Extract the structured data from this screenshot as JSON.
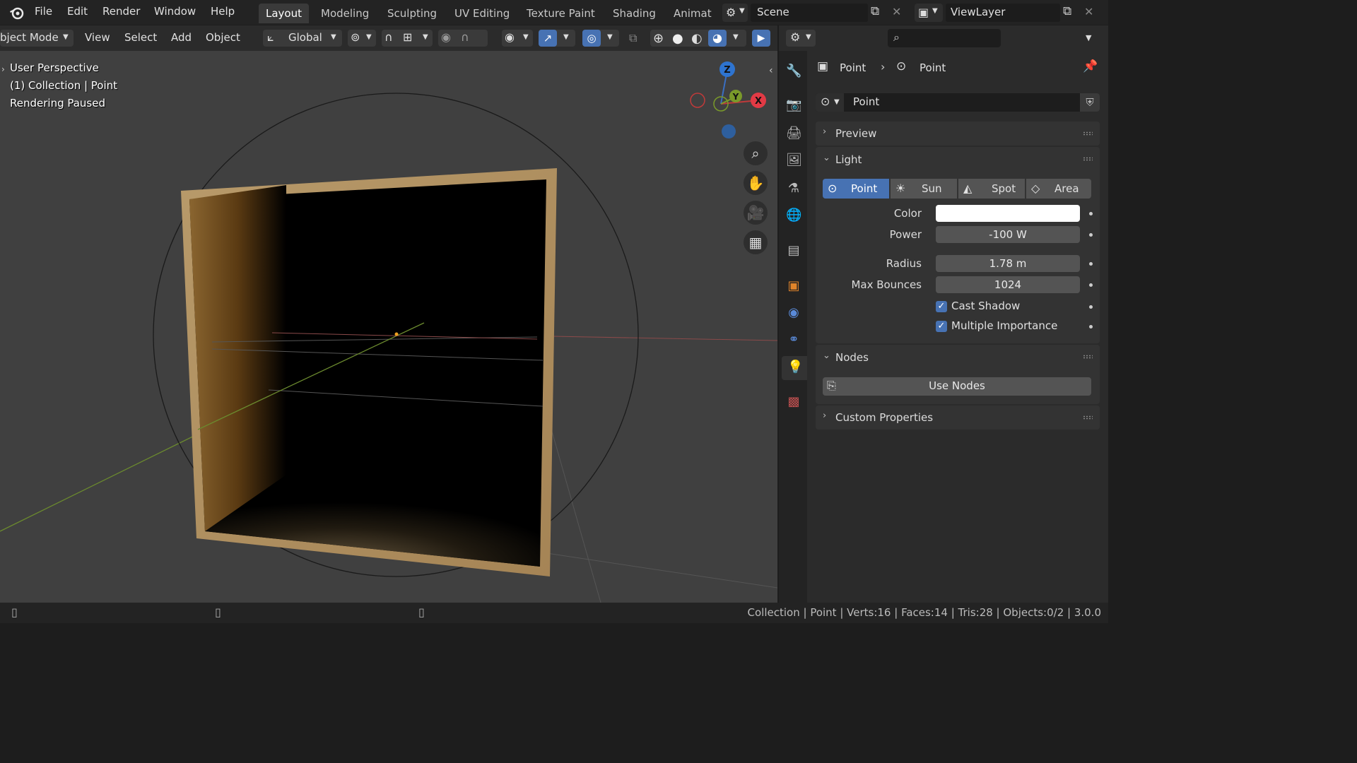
{
  "menu": {
    "file": "File",
    "edit": "Edit",
    "render": "Render",
    "window": "Window",
    "help": "Help"
  },
  "workspaces": [
    "Layout",
    "Modeling",
    "Sculpting",
    "UV Editing",
    "Texture Paint",
    "Shading",
    "Animat"
  ],
  "scene": {
    "name": "Scene",
    "view_layer": "ViewLayer"
  },
  "viewport_header": {
    "mode": "bject Mode",
    "view": "View",
    "select": "Select",
    "add": "Add",
    "object": "Object",
    "orientation": "Global"
  },
  "viewport_overlay": {
    "perspective": "User Perspective",
    "collection": "(1) Collection | Point",
    "status": "Rendering Paused"
  },
  "gizmo": {
    "z": "Z",
    "y": "Y",
    "x": "X"
  },
  "properties": {
    "breadcrumb_object": "Point",
    "breadcrumb_data": "Point",
    "datablock_name": "Point",
    "preview_title": "Preview",
    "light_title": "Light",
    "light_types": [
      "Point",
      "Sun",
      "Spot",
      "Area"
    ],
    "color_label": "Color",
    "color_value": "#ffffff",
    "power_label": "Power",
    "power_value": "-100 W",
    "radius_label": "Radius",
    "radius_value": "1.78 m",
    "max_bounces_label": "Max Bounces",
    "max_bounces_value": "1024",
    "cast_shadow_label": "Cast Shadow",
    "multiple_importance_label": "Multiple Importance",
    "nodes_title": "Nodes",
    "use_nodes_label": "Use Nodes",
    "custom_props_title": "Custom Properties"
  },
  "statusbar": {
    "info": "Collection | Point | Verts:16 | Faces:14 | Tris:28 | Objects:0/2 | 3.0.0"
  },
  "colors": {
    "accent": "#4772b3",
    "background": "#404040",
    "panel": "#2b2b2b"
  }
}
